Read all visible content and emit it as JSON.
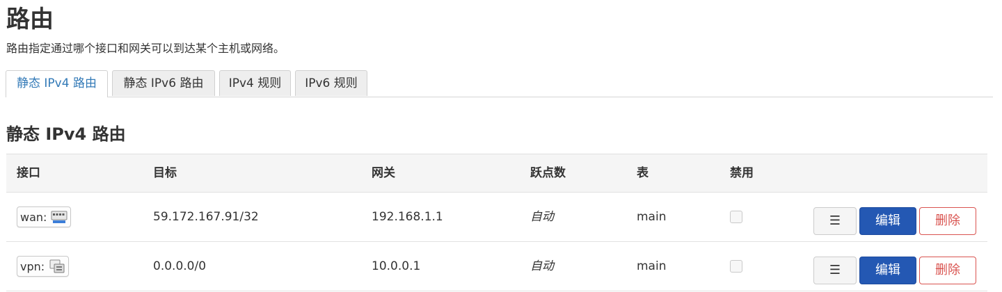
{
  "page": {
    "title": "路由",
    "description": "路由指定通过哪个接口和网关可以到达某个主机或网络。"
  },
  "tabs": [
    {
      "label": "静态 IPv4 路由",
      "active": true
    },
    {
      "label": "静态 IPv6 路由",
      "active": false
    },
    {
      "label": "IPv4 规则",
      "active": false
    },
    {
      "label": "IPv6 规则",
      "active": false
    }
  ],
  "section": {
    "title": "静态 IPv4 路由"
  },
  "table": {
    "headers": [
      "接口",
      "目标",
      "网关",
      "跃点数",
      "表",
      "禁用"
    ],
    "rows": [
      {
        "interface": "wan:",
        "interface_icon": "ethernet-port-icon",
        "target": "59.172.167.91/32",
        "gateway": "192.168.1.1",
        "metric": "自动",
        "table": "main",
        "disabled": false
      },
      {
        "interface": "vpn:",
        "interface_icon": "tunnel-icon",
        "target": "0.0.0.0/0",
        "gateway": "10.0.0.1",
        "metric": "自动",
        "table": "main",
        "disabled": false
      }
    ],
    "actions": {
      "more_label": "☰",
      "edit_label": "编辑",
      "delete_label": "删除"
    }
  },
  "colors": {
    "accent": "#337ab7",
    "primary_button": "#2458b3",
    "danger": "#d9534f"
  }
}
